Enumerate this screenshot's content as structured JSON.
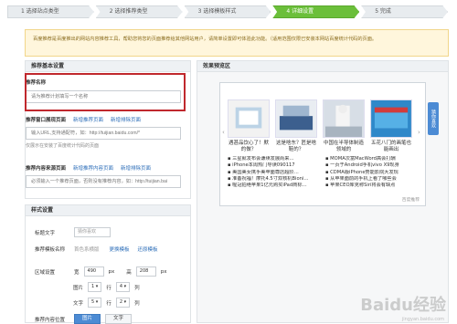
{
  "steps": [
    {
      "label": "1 选择站点类型"
    },
    {
      "label": "2 选择推荐类型"
    },
    {
      "label": "3 选择模板样式"
    },
    {
      "label": "4 详细设置"
    },
    {
      "label": "5 完成"
    }
  ],
  "notice": "百度推荐是百度推出的网站内容推荐工具，帮助您将您的页面推荐给其他网站用户，请简单设置即可体验此功能。（适用范围仅限已安装本网站百度统计代码的页面。",
  "left": {
    "section_title": "推荐基本设置",
    "name_label": "推荐名称",
    "name_placeholder": "请为推荐计划填写一个名称",
    "window_label": "推荐窗口展现页面",
    "window_link1": "新增推荐页面",
    "window_link2": "新增排除页面",
    "window_placeholder": "输入URL,支持通配符，如：http://tuijian.baidu.com/*",
    "window_hint": "仅展示在安装了百度统计代码的页面",
    "content_label": "推荐内容来源页面",
    "content_link1": "新增推荐内容页面",
    "content_link2": "新增排除页面",
    "content_placeholder": "必须输入一个推荐页面，否则没有推荐内容，如：http://tuijian.bai",
    "style_title": "样式设置",
    "title_label": "标题文字",
    "title_placeholder": "猜你喜欢",
    "tpl_label": "推荐模板名称",
    "tpl_value": "首色系横版",
    "tpl_link1": "更换模板",
    "tpl_link2": "还原模板",
    "area_label": "区域设置",
    "width_label": "宽",
    "width_value": "490",
    "height_label": "高",
    "height_value": "208",
    "px1": "px",
    "px2": "px",
    "img_label": "图片",
    "img_rows": "1",
    "img_rows_unit": "行",
    "img_cols": "4",
    "img_cols_unit": "列",
    "text_label": "文字",
    "text_rows": "5",
    "text_rows_unit": "行",
    "text_cols": "2",
    "text_cols_unit": "列",
    "pos_label": "推荐内容位置",
    "pos_opt1": "图片",
    "pos_opt2": "文字"
  },
  "preview": {
    "title": "效果预览区",
    "tab": "猜你喜欢",
    "thumbs": [
      {
        "caption": "遇甚品饮心了！默的做？"
      },
      {
        "caption": "这是啥东？匠是啥鞋的？"
      },
      {
        "caption": "中国在半导体制造领域的"
      },
      {
        "caption": "五花八门的画笔也能画出"
      }
    ],
    "news": [
      "三星就发布会谦续发展尚来…",
      "MOMA次富MacWord高会打酬",
      "iPhone本周热门导读090117",
      "一页于Android手机vivo X9现身",
      "美国美女携手美苹面尊店超阶…",
      "CDMA版iPhone势能影院大发现",
      "准备祝福！摩托4.5寸双核机Bioni…",
      "从苹果面前的手机上看了哪些会",
      "喔冠拍绝苹果1亿元购买iPad商标…",
      "苹果CEO库克称Siri将会有缺点"
    ],
    "footer": "百度推荐"
  },
  "watermark": "Baidu经验",
  "watermark_sub": "jingyan.baidu.com"
}
